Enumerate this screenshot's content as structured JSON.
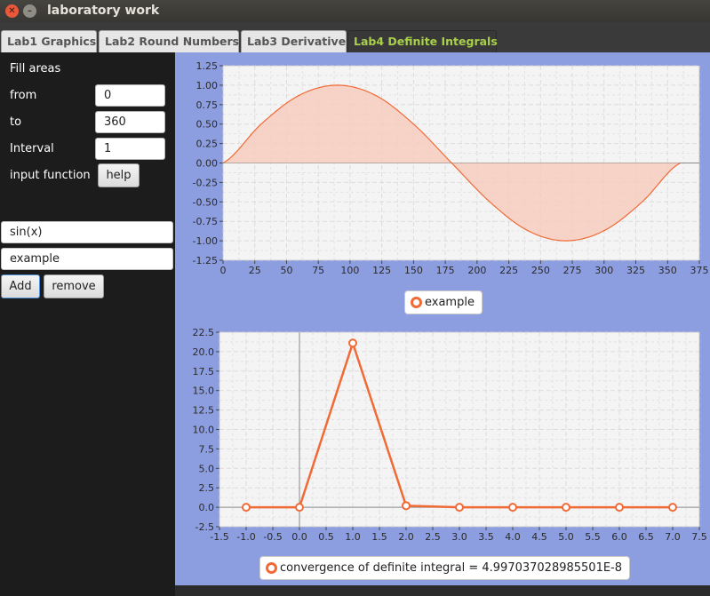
{
  "window": {
    "title": "laboratory work",
    "close_icon": "close-icon",
    "minimize_icon": "minimize-icon"
  },
  "tabs": [
    {
      "label": "Lab1 Graphics",
      "active": false
    },
    {
      "label": "Lab2 Round Numbers",
      "active": false
    },
    {
      "label": "Lab3 Derivative",
      "active": false
    },
    {
      "label": "Lab4 Definite Integrals",
      "active": true
    }
  ],
  "form": {
    "fill_areas_label": "Fill areas",
    "from_label": "from",
    "from_value": "0",
    "to_label": "to",
    "to_value": "360",
    "interval_label": "Interval",
    "interval_value": "1",
    "input_function_label": "input function",
    "help_button": "help",
    "function_value": "sin(x)",
    "name_value": "example",
    "add_button": "Add",
    "remove_button": "remove"
  },
  "colors": {
    "accent": "#f06a36",
    "fill": "#f7cbbd",
    "chart_bg": "#8d9ee0",
    "plot_bg": "#f4f4f4",
    "active_tab_text": "#a8d04a"
  },
  "chart_data": [
    {
      "type": "area",
      "title": "",
      "xlabel": "",
      "ylabel": "",
      "xlim": [
        0,
        375
      ],
      "ylim": [
        -1.25,
        1.25
      ],
      "x_ticks": [
        0,
        25,
        50,
        75,
        100,
        125,
        150,
        175,
        200,
        225,
        250,
        275,
        300,
        325,
        350,
        375
      ],
      "y_ticks": [
        1.25,
        1.0,
        0.75,
        0.5,
        0.25,
        0.0,
        -0.25,
        -0.5,
        -0.75,
        -1.0,
        -1.25
      ],
      "x_tick_labels": [
        "0",
        "25",
        "50",
        "75",
        "100",
        "125",
        "150",
        "175",
        "200",
        "225",
        "250",
        "275",
        "300",
        "325",
        "350",
        "375"
      ],
      "y_tick_labels": [
        "1.25",
        "1.00",
        "0.75",
        "0.50",
        "0.25",
        "0.00",
        "-0.25",
        "-0.50",
        "-0.75",
        "-1.00",
        "-1.25"
      ],
      "series": [
        {
          "name": "example",
          "x": [
            0,
            30,
            60,
            90,
            120,
            150,
            180,
            210,
            240,
            270,
            300,
            330,
            360
          ],
          "values": [
            0,
            0.5,
            0.87,
            1.0,
            0.87,
            0.5,
            0,
            -0.5,
            -0.87,
            -1.0,
            -0.87,
            -0.5,
            0
          ]
        }
      ],
      "grid": true,
      "legend": "bottom-center"
    },
    {
      "type": "line",
      "title": "",
      "xlabel": "",
      "ylabel": "",
      "xlim": [
        -1.5,
        7.5
      ],
      "ylim": [
        -2.5,
        22.5
      ],
      "x_ticks": [
        -1.5,
        -1.0,
        -0.5,
        0.0,
        0.5,
        1.0,
        1.5,
        2.0,
        2.5,
        3.0,
        3.5,
        4.0,
        4.5,
        5.0,
        5.5,
        6.0,
        6.5,
        7.0,
        7.5
      ],
      "y_ticks": [
        22.5,
        20.0,
        17.5,
        15.0,
        12.5,
        10.0,
        7.5,
        5.0,
        2.5,
        0.0,
        -2.5
      ],
      "x_tick_labels": [
        "-1.5",
        "-1.0",
        "-0.5",
        "0.0",
        "0.5",
        "1.0",
        "1.5",
        "2.0",
        "2.5",
        "3.0",
        "3.5",
        "4.0",
        "4.5",
        "5.0",
        "5.5",
        "6.0",
        "6.5",
        "7.0",
        "7.5"
      ],
      "y_tick_labels": [
        "22.5",
        "20.0",
        "17.5",
        "15.0",
        "12.5",
        "10.0",
        "7.5",
        "5.0",
        "2.5",
        "0.0",
        "-2.5"
      ],
      "series": [
        {
          "name": "convergence of definite integral = 4.997037028985501E-8",
          "x": [
            -1,
            0,
            1,
            2,
            3,
            4,
            5,
            6,
            7
          ],
          "values": [
            0,
            0,
            21.1,
            0.2,
            0,
            0,
            0,
            0,
            0
          ]
        }
      ],
      "grid": true,
      "legend": "bottom-center"
    }
  ]
}
